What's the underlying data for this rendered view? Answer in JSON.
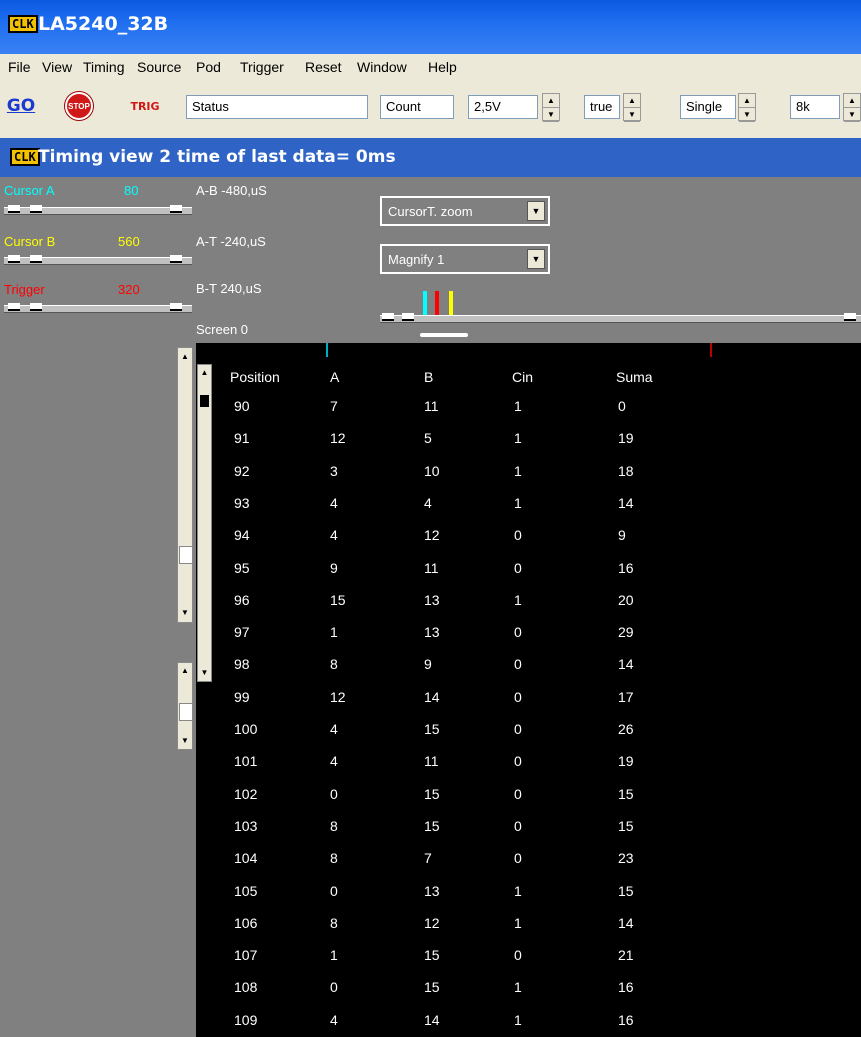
{
  "window": {
    "title": "LA5240_32B",
    "logo": "CLK"
  },
  "menu": [
    "File",
    "View",
    "Timing",
    "Source",
    "Pod",
    "Trigger",
    "Reset",
    "Window",
    "Help"
  ],
  "toolbar": {
    "go_label": "GO",
    "stop_label": "STOP",
    "trig_label": "TRIG",
    "status": "Status",
    "count": "Count",
    "voltage": "2,5V",
    "bool": "true",
    "mode": "Single",
    "depth": "8k"
  },
  "view": {
    "title": "Timing view  2   time of last data= 0ms"
  },
  "cursors": [
    {
      "label": "Cursor A",
      "value": "80",
      "color": "#00ffff"
    },
    {
      "label": "Cursor B",
      "value": "560",
      "color": "#ffff00"
    },
    {
      "label": "Trigger",
      "value": "320",
      "color": "#ff0000"
    }
  ],
  "measurements": {
    "ab": "A-B  -480,uS",
    "at": "A-T  -240,uS",
    "bt": "B-T  240,uS",
    "screen": "Screen  0"
  },
  "combos": {
    "zoom": "CursorT. zoom",
    "magnify": "Magnify 1"
  },
  "table": {
    "headers": [
      "Position",
      "A",
      "B",
      "Cin",
      "Suma"
    ],
    "rows": [
      [
        "90",
        "7",
        "11",
        "1",
        "0"
      ],
      [
        "91",
        "12",
        "5",
        "1",
        "19"
      ],
      [
        "92",
        "3",
        "10",
        "1",
        "18"
      ],
      [
        "93",
        "4",
        "4",
        "1",
        "14"
      ],
      [
        "94",
        "4",
        "12",
        "0",
        "9"
      ],
      [
        "95",
        "9",
        "11",
        "0",
        "16"
      ],
      [
        "96",
        "15",
        "13",
        "1",
        "20"
      ],
      [
        "97",
        "1",
        "13",
        "0",
        "29"
      ],
      [
        "98",
        "8",
        "9",
        "0",
        "14"
      ],
      [
        "99",
        "12",
        "14",
        "0",
        "17"
      ],
      [
        "100",
        "4",
        "15",
        "0",
        "26"
      ],
      [
        "101",
        "4",
        "11",
        "0",
        "19"
      ],
      [
        "102",
        "0",
        "15",
        "0",
        "15"
      ],
      [
        "103",
        "8",
        "15",
        "0",
        "15"
      ],
      [
        "104",
        "8",
        "7",
        "0",
        "23"
      ],
      [
        "105",
        "0",
        "13",
        "1",
        "15"
      ],
      [
        "106",
        "8",
        "12",
        "1",
        "14"
      ],
      [
        "107",
        "1",
        "15",
        "0",
        "21"
      ],
      [
        "108",
        "0",
        "15",
        "1",
        "16"
      ],
      [
        "109",
        "4",
        "14",
        "1",
        "16"
      ]
    ]
  }
}
